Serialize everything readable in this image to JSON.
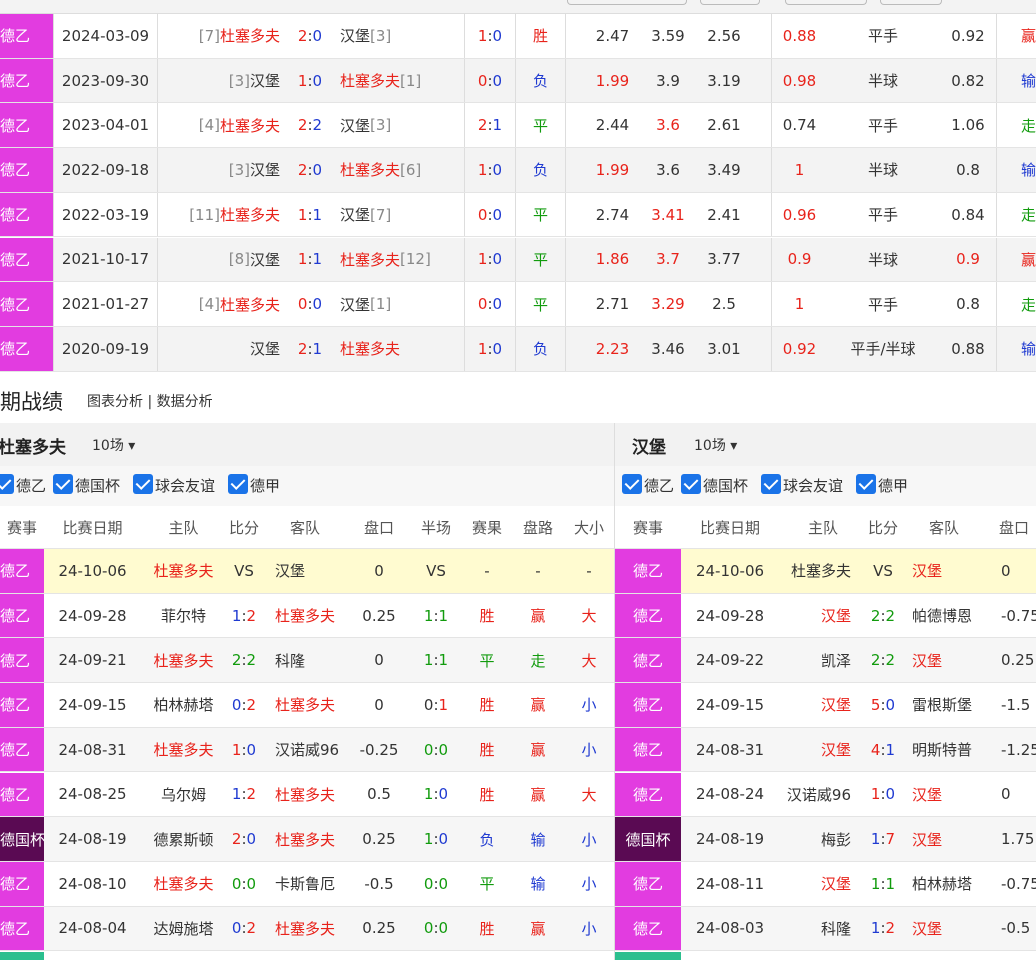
{
  "h2h_rows": [
    {
      "league": "德乙",
      "date": "2024-03-09",
      "home_rank": "[7]",
      "home": "杜塞多夫",
      "home_red": true,
      "score_h": "2",
      "score_a": "0",
      "away": "汉堡",
      "away_rank": "[3]",
      "away_red": false,
      "ht_h": "1",
      "ht_a": "0",
      "result": "胜",
      "odds1": "2.47",
      "odds2": "3.59",
      "odds3": "2.56",
      "ah1": "0.88",
      "line": "平手",
      "ah2": "0.92",
      "cover": "赢"
    },
    {
      "league": "德乙",
      "date": "2023-09-30",
      "home_rank": "[3]",
      "home": "汉堡",
      "home_red": false,
      "score_h": "1",
      "score_a": "0",
      "away": "杜塞多夫",
      "away_rank": "[1]",
      "away_red": true,
      "ht_h": "0",
      "ht_a": "0",
      "result": "负",
      "odds1": "1.99",
      "odds2": "3.9",
      "odds3": "3.19",
      "ah1": "0.98",
      "line": "半球",
      "ah2": "0.82",
      "cover": "输"
    },
    {
      "league": "德乙",
      "date": "2023-04-01",
      "home_rank": "[4]",
      "home": "杜塞多夫",
      "home_red": true,
      "score_h": "2",
      "score_a": "2",
      "away": "汉堡",
      "away_rank": "[3]",
      "away_red": false,
      "ht_h": "2",
      "ht_a": "1",
      "result": "平",
      "odds1": "2.44",
      "odds2": "3.6",
      "odds3": "2.61",
      "ah1": "0.74",
      "line": "平手",
      "ah2": "1.06",
      "cover": "走"
    },
    {
      "league": "德乙",
      "date": "2022-09-18",
      "home_rank": "[3]",
      "home": "汉堡",
      "home_red": false,
      "score_h": "2",
      "score_a": "0",
      "away": "杜塞多夫",
      "away_rank": "[6]",
      "away_red": true,
      "ht_h": "1",
      "ht_a": "0",
      "result": "负",
      "odds1": "1.99",
      "odds2": "3.6",
      "odds3": "3.49",
      "ah1": "1",
      "line": "半球",
      "ah2": "0.8",
      "cover": "输"
    },
    {
      "league": "德乙",
      "date": "2022-03-19",
      "home_rank": "[11]",
      "home": "杜塞多夫",
      "home_red": true,
      "score_h": "1",
      "score_a": "1",
      "away": "汉堡",
      "away_rank": "[7]",
      "away_red": false,
      "ht_h": "0",
      "ht_a": "0",
      "result": "平",
      "odds1": "2.74",
      "odds2": "3.41",
      "odds3": "2.41",
      "ah1": "0.96",
      "line": "平手",
      "ah2": "0.84",
      "cover": "走"
    },
    {
      "league": "德乙",
      "date": "2021-10-17",
      "home_rank": "[8]",
      "home": "汉堡",
      "home_red": false,
      "score_h": "1",
      "score_a": "1",
      "away": "杜塞多夫",
      "away_rank": "[12]",
      "away_red": true,
      "ht_h": "1",
      "ht_a": "0",
      "result": "平",
      "odds1": "1.86",
      "odds2": "3.7",
      "odds3": "3.77",
      "ah1": "0.9",
      "line": "半球",
      "ah2": "0.9",
      "cover": "赢"
    },
    {
      "league": "德乙",
      "date": "2021-01-27",
      "home_rank": "[4]",
      "home": "杜塞多夫",
      "home_red": true,
      "score_h": "0",
      "score_a": "0",
      "away": "汉堡",
      "away_rank": "[1]",
      "away_red": false,
      "ht_h": "0",
      "ht_a": "0",
      "result": "平",
      "odds1": "2.71",
      "odds2": "3.29",
      "odds3": "2.5",
      "ah1": "1",
      "line": "平手",
      "ah2": "0.8",
      "cover": "走"
    },
    {
      "league": "德乙",
      "date": "2020-09-19",
      "home_rank": "",
      "home": "汉堡",
      "home_red": false,
      "score_h": "2",
      "score_a": "1",
      "away": "杜塞多夫",
      "away_rank": "",
      "away_red": true,
      "ht_h": "1",
      "ht_a": "0",
      "result": "负",
      "odds1": "2.23",
      "odds2": "3.46",
      "odds3": "3.01",
      "ah1": "0.92",
      "line": "平手/半球",
      "ah2": "0.88",
      "cover": "输"
    }
  ],
  "section": {
    "title": "期战绩",
    "links": "图表分析 | 数据分析"
  },
  "left_team": {
    "name": "杜塞多夫",
    "count": "10场 ▾"
  },
  "right_team": {
    "name": "汉堡",
    "count": "10场 ▾"
  },
  "filters": [
    "德乙",
    "德国杯",
    "球会友谊",
    "德甲"
  ],
  "left_headers": [
    "赛事",
    "比赛日期",
    "主队",
    "比分",
    "客队",
    "盘口",
    "半场",
    "赛果",
    "盘路",
    "大小"
  ],
  "right_headers": [
    "赛事",
    "比赛日期",
    "主队",
    "比分",
    "客队",
    "盘口"
  ],
  "left_rows": [
    {
      "league": "德乙",
      "date": "24-10-06",
      "home": "杜塞多夫",
      "home_red": true,
      "sh": "VS",
      "sa": "",
      "away": "汉堡",
      "away_red": false,
      "line": "0",
      "ht": "VS",
      "res": "-",
      "ah": "-",
      "ou": "-",
      "upcoming": true
    },
    {
      "league": "德乙",
      "date": "24-09-28",
      "home": "菲尔特",
      "home_red": false,
      "sh": "1",
      "sa": "2",
      "away": "杜塞多夫",
      "away_red": true,
      "line": "0.25",
      "ht": "1:1",
      "res": "胜",
      "ah": "赢",
      "ou": "大"
    },
    {
      "league": "德乙",
      "date": "24-09-21",
      "home": "杜塞多夫",
      "home_red": true,
      "sh": "2",
      "sa": "2",
      "away": "科隆",
      "away_red": false,
      "line": "0",
      "ht": "1:1",
      "res": "平",
      "ah": "走",
      "ou": "大"
    },
    {
      "league": "德乙",
      "date": "24-09-15",
      "home": "柏林赫塔",
      "home_red": false,
      "sh": "0",
      "sa": "2",
      "away": "杜塞多夫",
      "away_red": true,
      "line": "0",
      "ht": "0:1",
      "res": "胜",
      "ah": "赢",
      "ou": "小"
    },
    {
      "league": "德乙",
      "date": "24-08-31",
      "home": "杜塞多夫",
      "home_red": true,
      "sh": "1",
      "sa": "0",
      "away": "汉诺威96",
      "away_red": false,
      "line": "-0.25",
      "ht": "0:0",
      "res": "胜",
      "ah": "赢",
      "ou": "小"
    },
    {
      "league": "德乙",
      "date": "24-08-25",
      "home": "乌尔姆",
      "home_red": false,
      "sh": "1",
      "sa": "2",
      "away": "杜塞多夫",
      "away_red": true,
      "line": "0.5",
      "ht": "1:0",
      "res": "胜",
      "ah": "赢",
      "ou": "大"
    },
    {
      "league": "德国杯",
      "date": "24-08-19",
      "home": "德累斯顿",
      "home_red": false,
      "sh": "2",
      "sa": "0",
      "away": "杜塞多夫",
      "away_red": true,
      "line": "0.25",
      "ht": "1:0",
      "res": "负",
      "ah": "输",
      "ou": "小"
    },
    {
      "league": "德乙",
      "date": "24-08-10",
      "home": "杜塞多夫",
      "home_red": true,
      "sh": "0",
      "sa": "0",
      "away": "卡斯鲁厄",
      "away_red": false,
      "line": "-0.5",
      "ht": "0:0",
      "res": "平",
      "ah": "输",
      "ou": "小"
    },
    {
      "league": "德乙",
      "date": "24-08-04",
      "home": "达姆施塔",
      "home_red": false,
      "sh": "0",
      "sa": "2",
      "away": "杜塞多夫",
      "away_red": true,
      "line": "0.25",
      "ht": "0:0",
      "res": "胜",
      "ah": "赢",
      "ou": "小"
    }
  ],
  "right_rows": [
    {
      "league": "德乙",
      "date": "24-10-06",
      "home": "杜塞多夫",
      "home_red": false,
      "sh": "VS",
      "sa": "",
      "away": "汉堡",
      "away_red": true,
      "line": "0",
      "upcoming": true
    },
    {
      "league": "德乙",
      "date": "24-09-28",
      "home": "汉堡",
      "home_red": true,
      "sh": "2",
      "sa": "2",
      "away": "帕德博恩",
      "away_red": false,
      "line": "-0.75"
    },
    {
      "league": "德乙",
      "date": "24-09-22",
      "home": "凯泽",
      "home_red": false,
      "sh": "2",
      "sa": "2",
      "away": "汉堡",
      "away_red": true,
      "line": "0.25"
    },
    {
      "league": "德乙",
      "date": "24-09-15",
      "home": "汉堡",
      "home_red": true,
      "sh": "5",
      "sa": "0",
      "away": "雷根斯堡",
      "away_red": false,
      "line": "-1.5"
    },
    {
      "league": "德乙",
      "date": "24-08-31",
      "home": "汉堡",
      "home_red": true,
      "sh": "4",
      "sa": "1",
      "away": "明斯特普",
      "away_red": false,
      "line": "-1.25"
    },
    {
      "league": "德乙",
      "date": "24-08-24",
      "home": "汉诺威96",
      "home_red": false,
      "sh": "1",
      "sa": "0",
      "away": "汉堡",
      "away_red": true,
      "line": "0"
    },
    {
      "league": "德国杯",
      "date": "24-08-19",
      "home": "梅彭",
      "home_red": false,
      "sh": "1",
      "sa": "7",
      "away": "汉堡",
      "away_red": true,
      "line": "1.75"
    },
    {
      "league": "德乙",
      "date": "24-08-11",
      "home": "汉堡",
      "home_red": true,
      "sh": "1",
      "sa": "1",
      "away": "柏林赫塔",
      "away_red": false,
      "line": "-0.75"
    },
    {
      "league": "德乙",
      "date": "24-08-03",
      "home": "科隆",
      "home_red": false,
      "sh": "1",
      "sa": "2",
      "away": "汉堡",
      "away_red": true,
      "line": "-0.5"
    }
  ],
  "colors": {
    "league": "#e23ce0",
    "cup": "#5a0a53",
    "red": "#e8231b",
    "blue": "#1f3ad1",
    "green": "#119b0d"
  }
}
